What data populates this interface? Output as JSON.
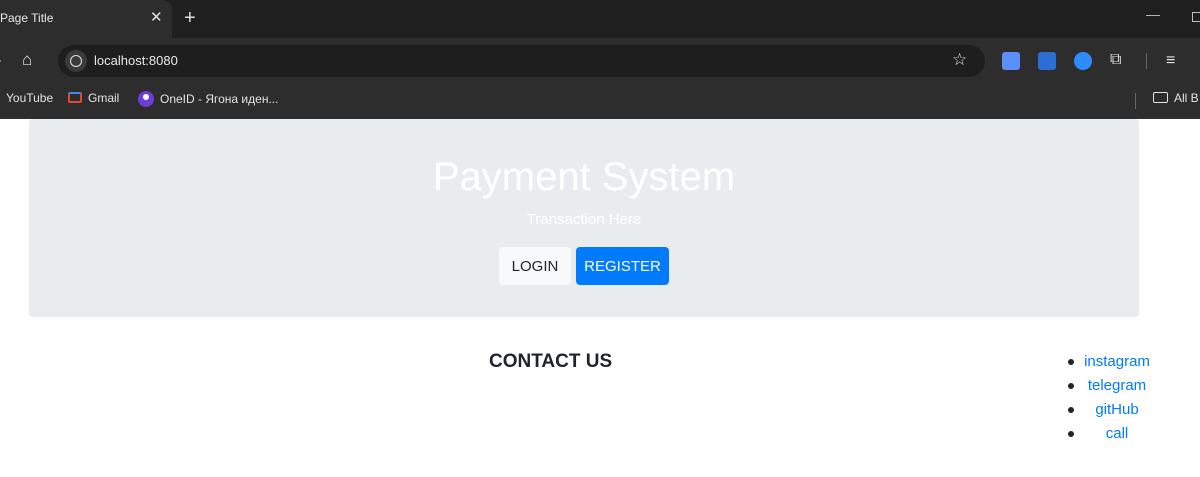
{
  "browser": {
    "tab_title": "Page Title",
    "tab_close": "✕",
    "new_tab": "+",
    "url": "localhost:8080",
    "bookmarks": [
      {
        "label": "YouTube"
      },
      {
        "label": "Gmail"
      },
      {
        "label": "OneID - Ягона иден..."
      }
    ],
    "all_bookmarks": "All B"
  },
  "hero": {
    "title": "Payment System",
    "subtitle": "Transaction Here",
    "login_label": "LOGIN",
    "register_label": "REGISTER"
  },
  "contact": {
    "title": "CONTACT US",
    "links": [
      {
        "label": "instagram"
      },
      {
        "label": "telegram"
      },
      {
        "label": "gitHub"
      },
      {
        "label": "call"
      }
    ]
  },
  "colors": {
    "primary": "#007bff",
    "jumbotron_bg": "#e9ecef",
    "light_button": "#f8f9fa",
    "chrome_dark": "#2d2d2d"
  }
}
